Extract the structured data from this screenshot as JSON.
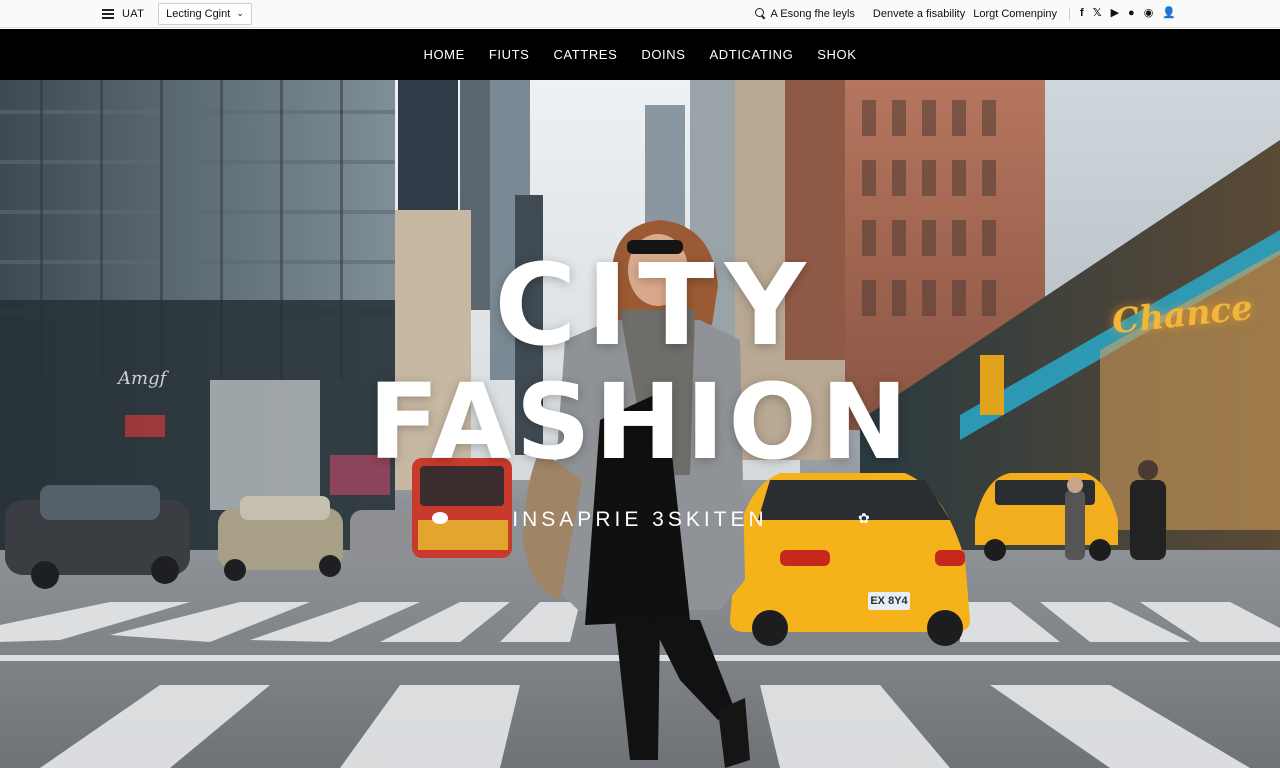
{
  "topbar": {
    "menu_label": "UAT",
    "language_select": "Lecting Cgint",
    "search_text": "A Esong fhe leyls",
    "link_1": "Denvete a fisability",
    "link_2": "Lorgt Comenpiny",
    "socials": [
      {
        "name": "facebook-icon",
        "glyph": "f"
      },
      {
        "name": "twitter-icon",
        "glyph": "𝕏"
      },
      {
        "name": "youtube-icon",
        "glyph": "▶"
      },
      {
        "name": "pinterest-icon",
        "glyph": "●"
      },
      {
        "name": "instagram-icon",
        "glyph": "◉"
      },
      {
        "name": "user-icon",
        "glyph": "👤"
      }
    ]
  },
  "nav": {
    "items": [
      "HOME",
      "FIUTS",
      "CATTRES",
      "DOINS",
      "ADTICATING",
      "SHOK"
    ]
  },
  "hero": {
    "title_line1": "CITY",
    "title_line2": "FASHION",
    "tagline": "INSAPRIE 3SKITEN",
    "store_sign": "Chance",
    "building_sign": "Amgf",
    "plate": "EX 8Y4"
  },
  "colors": {
    "nav_bg": "#000000",
    "topbar_bg": "#fafafa",
    "taxi_yellow": "#f5b21a",
    "accent_teal": "#2aa8c9"
  }
}
